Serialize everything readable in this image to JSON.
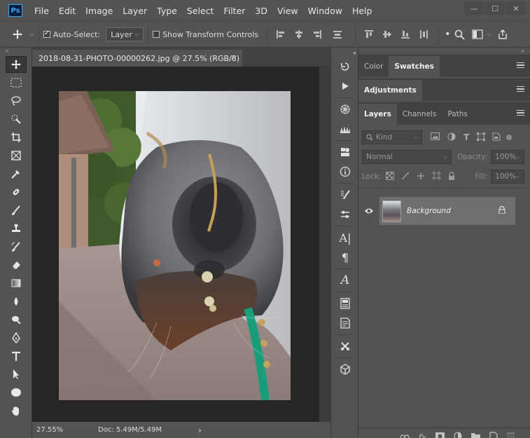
{
  "app": {
    "logo_text": "Ps"
  },
  "menu": [
    {
      "id": "file",
      "label": "File"
    },
    {
      "id": "edit",
      "label": "Edit"
    },
    {
      "id": "image",
      "label": "Image"
    },
    {
      "id": "layer",
      "label": "Layer"
    },
    {
      "id": "type",
      "label": "Type"
    },
    {
      "id": "select",
      "label": "Select"
    },
    {
      "id": "filter",
      "label": "Filter"
    },
    {
      "id": "3d",
      "label": "3D"
    },
    {
      "id": "view",
      "label": "View"
    },
    {
      "id": "window",
      "label": "Window"
    },
    {
      "id": "help",
      "label": "Help"
    }
  ],
  "window_controls": {
    "minimize": "—",
    "maximize": "☐",
    "close": "✕"
  },
  "options": {
    "auto_select_label": "Auto-Select:",
    "auto_select_checked": true,
    "auto_select_target": "Layer",
    "show_transform_label": "Show Transform Controls",
    "show_transform_checked": false
  },
  "document": {
    "tab_title": "2018-08-31-PHOTO-00000262.jpg @ 27.5% (RGB/8)",
    "close_glyph": "×"
  },
  "status": {
    "zoom": "27.55%",
    "doc_size": "Doc: 5.49M/5.49M",
    "arrow": "›"
  },
  "panels": {
    "group1": {
      "tabs": [
        "Color",
        "Swatches"
      ],
      "active": 1
    },
    "group2": {
      "tabs": [
        "Adjustments"
      ],
      "active": 0
    },
    "group3": {
      "tabs": [
        "Layers",
        "Channels",
        "Paths"
      ],
      "active": 0
    }
  },
  "layers": {
    "filter_kind": "Kind",
    "blend_mode": "Normal",
    "opacity_label": "Opacity:",
    "opacity_value": "100%",
    "lock_label": "Lock:",
    "fill_label": "Fill:",
    "fill_value": "100%",
    "items": [
      {
        "name": "Background",
        "visible": true,
        "locked": true
      }
    ],
    "footer_icons": [
      "link-icon",
      "fx-icon",
      "mask-icon",
      "adjustment-icon",
      "group-folder-icon",
      "new-layer-icon",
      "trash-icon"
    ],
    "fx_label": "fx"
  },
  "colors": {
    "ui_bg": "#535353",
    "canvas_bg": "#262626",
    "accent_ps": "#30a8ff",
    "selected_layer": "#6e6e6e"
  }
}
